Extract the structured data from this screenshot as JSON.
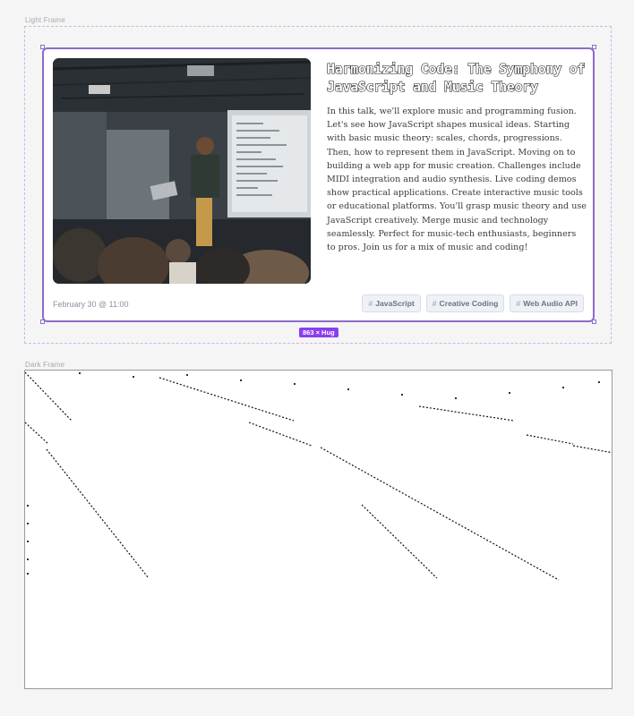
{
  "frames": {
    "light_label": "Light Frame",
    "dark_label": "Dark Frame",
    "size_badge": "863 × Hug"
  },
  "card": {
    "title": "Harmonizing Code: The Symphony of JavaScript and Music Theory",
    "description": "In this talk, we'll explore music and programming fusion. Let's see how JavaScript shapes musical ideas. Starting with basic music theory: scales, chords, progressions. Then, how to represent them in JavaScript. Moving on to building a web app for music creation. Challenges include MIDI integration and audio synthesis. Live coding demos show practical applications. Create interactive music tools or educational platforms. You'll grasp music theory and use JavaScript creatively. Merge music and technology seamlessly. Perfect for music-tech enthusiasts, beginners to pros. Join us for a mix of music and coding!",
    "date": "February 30 @ 11:00",
    "tags": [
      {
        "hash": "#",
        "label": "JavaScript"
      },
      {
        "hash": "#",
        "label": "Creative Coding"
      },
      {
        "hash": "#",
        "label": "Web Audio API"
      }
    ]
  },
  "colors": {
    "selection": "#8b6cc9",
    "badge": "#8a3ff0",
    "tag_bg": "#eef1f5"
  }
}
